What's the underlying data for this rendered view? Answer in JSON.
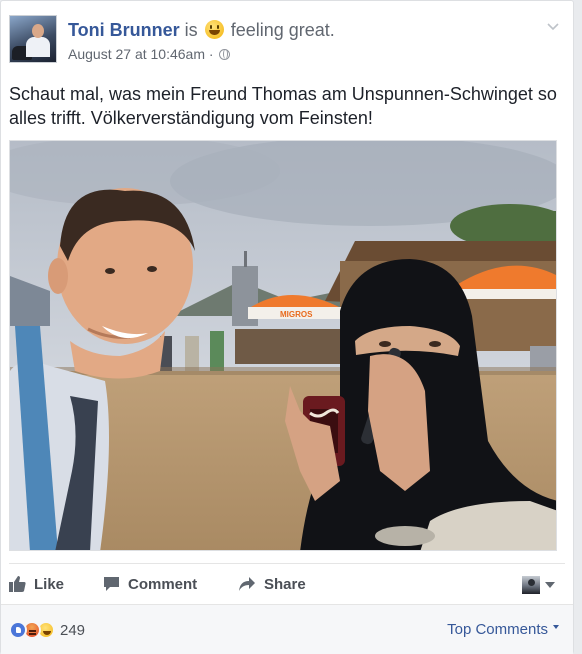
{
  "post": {
    "author_name": "Toni Brunner",
    "is_text": "is",
    "feeling_text": "feeling great.",
    "timestamp": "August 27 at 10:46am",
    "separator": "·",
    "audience_icon": "globe-icon",
    "text": "Schaut mal, was mein Freund Thomas am Unspunnen-Schwinget so alles trifft. Völkerverständigung vom Feinsten!",
    "photo_sign": "MIGROS"
  },
  "actions": {
    "like_label": "Like",
    "comment_label": "Comment",
    "share_label": "Share"
  },
  "footer": {
    "reaction_count": "249",
    "reactions": [
      "like",
      "angry",
      "haha"
    ],
    "sort_label": "Top Comments"
  },
  "colors": {
    "link_blue": "#365899",
    "secondary_text": "#616770",
    "action_text": "#4b4f56",
    "footer_bg": "#f6f7f9"
  }
}
